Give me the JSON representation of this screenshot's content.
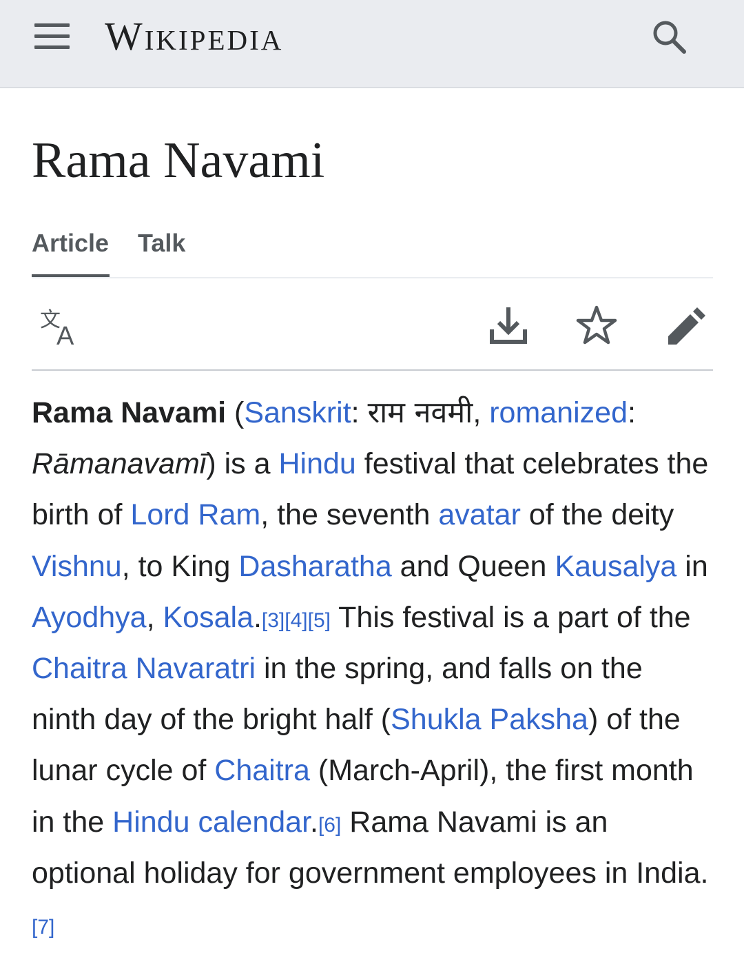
{
  "header": {
    "menu_icon": "hamburger-menu-icon",
    "logo_text": "Wikipedia",
    "search_icon": "search-icon",
    "background": "#eaecf0"
  },
  "page": {
    "title": "Rama Navami"
  },
  "tabs": [
    {
      "label": "Article",
      "active": true
    },
    {
      "label": "Talk",
      "active": false
    }
  ],
  "toolbar": {
    "language_icon": "language-icon",
    "download_icon": "download-icon",
    "watch_icon": "star-icon",
    "edit_icon": "pencil-edit-icon"
  },
  "colors": {
    "link": "#3366cc",
    "text": "#202122",
    "icon": "#54595d"
  },
  "article": {
    "term": "Rama Navami",
    "open_paren": " (",
    "sanskrit_link": "Sanskrit",
    "colon1": ": ",
    "devanagari": "राम नवमी",
    "comma1": ", ",
    "romanized_link": "romanized",
    "colon2": ": ",
    "romanized_term": "Rāmanavamī",
    "t1": ") is a ",
    "hindu_link": "Hindu",
    "t2": " festival that celebrates the birth of ",
    "lord_ram_link": "Lord Ram",
    "t3": ", the seventh ",
    "avatar_link": "avatar",
    "t4": " of the deity ",
    "vishnu_link": "Vishnu",
    "t5": ", to King ",
    "dasharatha_link": "Dasharatha",
    "t6": " and Queen ",
    "kausalya_link": "Kausalya",
    "t7": " in ",
    "ayodhya_link": "Ayodhya",
    "t8": ", ",
    "kosala_link": "Kosala",
    "t9": ".",
    "ref3": "[3]",
    "ref4": "[4]",
    "ref5": "[5]",
    "t10": " This festival is a part of the ",
    "chaitra_navaratri_link": "Chaitra Navaratri",
    "t11": " in the spring, and falls on the ninth day of the bright half (",
    "shukla_paksha_link": "Shukla Paksha",
    "t12": ") of the lunar cycle of ",
    "chaitra_link": "Chaitra",
    "t13": " (March-April), the first month in the ",
    "hindu_calendar_link": "Hindu calendar",
    "t14": ".",
    "ref6": "[6]",
    "t15": " Rama Navami is an optional holiday for government employees in India.",
    "ref7": "[7]"
  }
}
